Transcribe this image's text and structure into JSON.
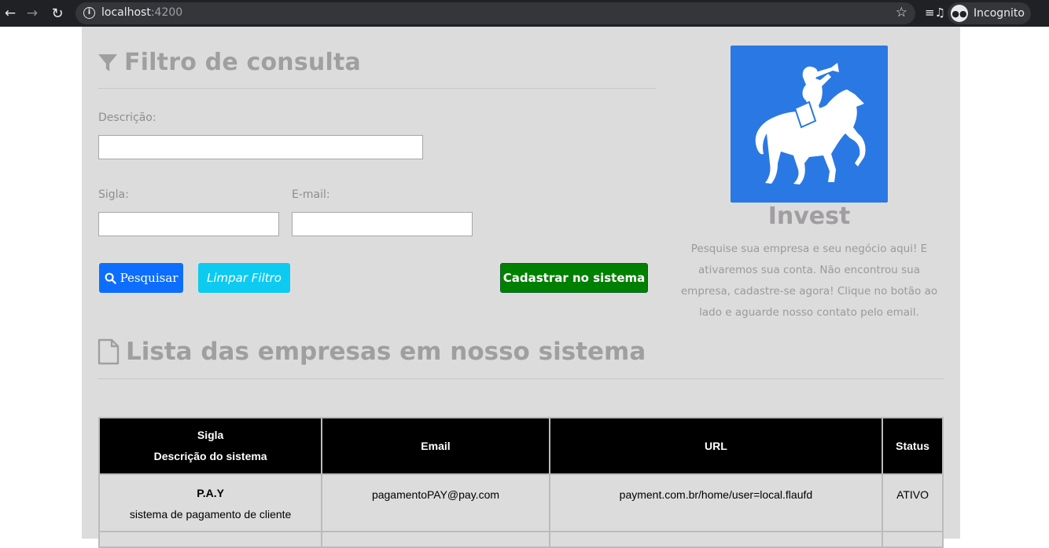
{
  "browser": {
    "host": "localhost",
    "port": ":4200",
    "incognito_label": "Incognito"
  },
  "filter": {
    "title": "Filtro de consulta",
    "descricao_label": "Descrição:",
    "descricao_value": "",
    "sigla_label": "Sigla:",
    "sigla_value": "",
    "email_label": "E-mail:",
    "email_value": "",
    "search_button": "Pesquisar",
    "clear_button": "Limpar Filtro",
    "register_button": "Cadastrar no sistema"
  },
  "brand": {
    "name": "Invest",
    "blurb": "Pesquise sua empresa e seu negócio aqui! E ativaremos sua conta. Não encontrou sua empresa, cadastre-se agora! Clique no botão ao lado e aguarde nosso contato pelo email.",
    "logo_color": "#2a78e4"
  },
  "list": {
    "title": "Lista das empresas em nosso sistema",
    "headers": {
      "sigla": "Sigla",
      "descricao": "Descrição do sistema",
      "email": "Email",
      "url": "URL",
      "status": "Status"
    },
    "rows": [
      {
        "sigla": "P.A.Y",
        "descricao": "sistema de pagamento de cliente",
        "email": "pagamentoPAY@pay.com",
        "url": "payment.com.br/home/user=local.flaufd",
        "status": "ATIVO"
      }
    ]
  },
  "colors": {
    "primary_button": "#0d6efd",
    "info_button": "#0dcaf0",
    "success_button": "#008000",
    "page_background": "#dddcdd",
    "table_header": "#000000"
  }
}
